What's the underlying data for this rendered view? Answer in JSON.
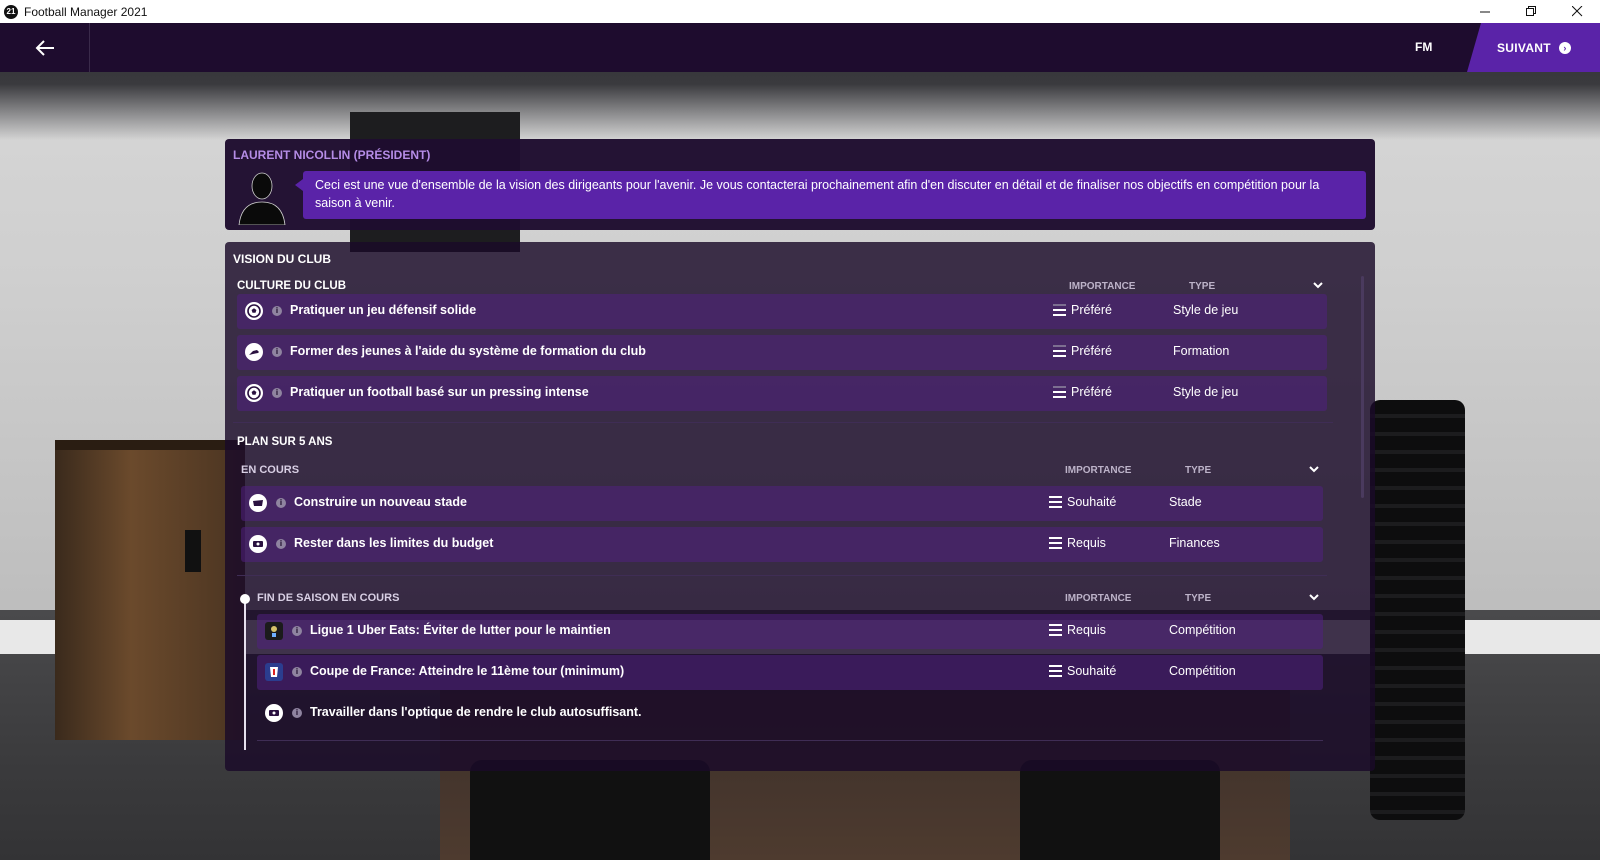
{
  "window": {
    "title": "Football Manager 2021",
    "logo_text": "21",
    "controls": [
      "minimize-icon",
      "restore-icon",
      "close-icon"
    ]
  },
  "topbar": {
    "back_icon": "arrow-left-icon",
    "fm_label": "FM",
    "next_label": "SUIVANT",
    "accent": "#5a23a8"
  },
  "president": {
    "name": "LAURENT NICOLLIN (PRÉSIDENT)",
    "avatar_icon": "person-silhouette-icon",
    "message": "Ceci est une vue d'ensemble de la vision des dirigeants pour l'avenir. Je vous contacterai prochainement afin d'en discuter en détail et de finaliser nos objectifs en compétition pour la saison à venir."
  },
  "vision": {
    "title": "VISION DU CLUB",
    "culture": {
      "title": "CULTURE DU CLUB",
      "col_importance": "IMPORTANCE",
      "col_type": "TYPE",
      "rows": [
        {
          "icon": "football-icon",
          "label": "Pratiquer un jeu défensif solide",
          "importance": "Préféré",
          "type": "Style de jeu"
        },
        {
          "icon": "boot-icon",
          "label": "Former des jeunes à l'aide du système de formation du club",
          "importance": "Préféré",
          "type": "Formation"
        },
        {
          "icon": "football-icon",
          "label": "Pratiquer un football basé sur un pressing intense",
          "importance": "Préféré",
          "type": "Style de jeu"
        }
      ]
    },
    "plan": {
      "title": "PLAN SUR 5 ANS",
      "in_progress": {
        "title": "EN COURS",
        "col_importance": "IMPORTANCE",
        "col_type": "TYPE",
        "rows": [
          {
            "icon": "stadium-icon",
            "label": "Construire un nouveau stade",
            "importance": "Souhaité",
            "type": "Stade"
          },
          {
            "icon": "money-icon",
            "label": "Rester dans les limites du budget",
            "importance": "Requis",
            "type": "Finances"
          }
        ]
      },
      "season_end": {
        "title": "FIN DE SAISON EN COURS",
        "col_importance": "IMPORTANCE",
        "col_type": "TYPE",
        "rows": [
          {
            "icon": "ligue1-logo-icon",
            "label": "Ligue 1 Uber Eats: Éviter de lutter pour le maintien",
            "importance": "Requis",
            "type": "Compétition"
          },
          {
            "icon": "coupe-de-france-logo-icon",
            "label": "Coupe de France: Atteindre le 11ème tour (minimum)",
            "importance": "Souhaité",
            "type": "Compétition"
          },
          {
            "icon": "money-icon",
            "label": "Travailler dans l'optique de rendre le club autosuffisant.",
            "importance": "",
            "type": ""
          }
        ]
      }
    }
  }
}
